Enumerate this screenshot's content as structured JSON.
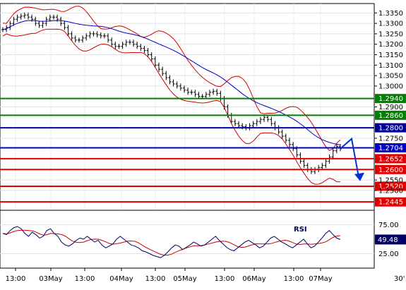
{
  "chart_data": {
    "type": "candlestick",
    "price_axis": {
      "ylim": [
        1.2405,
        1.3395
      ],
      "ticks": [
        "1.3350",
        "1.3300",
        "1.3250",
        "1.3200",
        "1.3150",
        "1.3100",
        "1.3050",
        "1.3000",
        "1.2900",
        "1.2750",
        "1.2550",
        "1.2500"
      ],
      "grid": true
    },
    "price_bars": [
      1.327,
      1.328,
      1.33,
      1.332,
      1.333,
      1.3335,
      1.334,
      1.333,
      1.332,
      1.33,
      1.329,
      1.33,
      1.332,
      1.333,
      1.333,
      1.332,
      1.33,
      1.328,
      1.325,
      1.323,
      1.322,
      1.322,
      1.323,
      1.324,
      1.325,
      1.325,
      1.3245,
      1.324,
      1.324,
      1.322,
      1.32,
      1.319,
      1.319,
      1.32,
      1.321,
      1.321,
      1.32,
      1.319,
      1.318,
      1.317,
      1.315,
      1.313,
      1.31,
      1.308,
      1.306,
      1.304,
      1.302,
      1.301,
      1.3,
      1.299,
      1.298,
      1.297,
      1.297,
      1.296,
      1.295,
      1.295,
      1.296,
      1.297,
      1.2975,
      1.2965,
      1.294,
      1.29,
      1.286,
      1.283,
      1.282,
      1.281,
      1.2805,
      1.28,
      1.281,
      1.282,
      1.283,
      1.284,
      1.285,
      1.284,
      1.282,
      1.28,
      1.278,
      1.276,
      1.274,
      1.272,
      1.27,
      1.267,
      1.264,
      1.262,
      1.26,
      1.259,
      1.26,
      1.261,
      1.262,
      1.264,
      1.266,
      1.269,
      1.271,
      1.27
    ],
    "indicators": [
      {
        "name": "Upper Bollinger band",
        "color": "#cc0000"
      },
      {
        "name": "Lower Bollinger band",
        "color": "#cc0000"
      },
      {
        "name": "Moving average",
        "color": "#0000cc"
      }
    ],
    "levels": [
      {
        "value": "1.2940",
        "price": 1.294,
        "color": "#008000"
      },
      {
        "value": "1.2860",
        "price": 1.286,
        "color": "#008000"
      },
      {
        "value": "1.2800",
        "price": 1.28,
        "color": "#000099"
      },
      {
        "value": "1.2704",
        "price": 1.2704,
        "color": "#0000cc"
      },
      {
        "value": "1.2652",
        "price": 1.2652,
        "color": "#e00000"
      },
      {
        "value": "1.2600",
        "price": 1.26,
        "color": "#e00000"
      },
      {
        "value": "1.2520",
        "price": 1.252,
        "color": "#e00000"
      },
      {
        "value": "1.2445",
        "price": 1.2445,
        "color": "#e00000"
      }
    ],
    "projection": {
      "direction": "down",
      "color": "#0033cc"
    },
    "rsi": {
      "title": "RSI",
      "current": "49.48",
      "ticks": [
        "75.00",
        "25.00"
      ],
      "ylim": [
        0,
        100
      ],
      "values": [
        60,
        58,
        65,
        70,
        72,
        68,
        60,
        55,
        62,
        58,
        52,
        55,
        65,
        68,
        60,
        55,
        45,
        40,
        38,
        42,
        48,
        52,
        50,
        55,
        50,
        45,
        48,
        40,
        35,
        38,
        42,
        50,
        55,
        50,
        45,
        40,
        38,
        35,
        30,
        28,
        25,
        22,
        20,
        18,
        22,
        28,
        35,
        40,
        38,
        32,
        36,
        40,
        45,
        42,
        38,
        40,
        45,
        50,
        55,
        48,
        42,
        36,
        32,
        30,
        35,
        40,
        45,
        48,
        44,
        40,
        35,
        38,
        45,
        52,
        55,
        50,
        45,
        42,
        38,
        35,
        40,
        45,
        50,
        42,
        35,
        38,
        45,
        52,
        60,
        65,
        58,
        52,
        49.48
      ]
    },
    "x_axis": {
      "ticks": [
        "13:00",
        "03May",
        "13:00",
        "04May",
        "13:00",
        "05May",
        "13:00",
        "06May",
        "13:00",
        "07May"
      ],
      "timeframe": "30'"
    }
  }
}
